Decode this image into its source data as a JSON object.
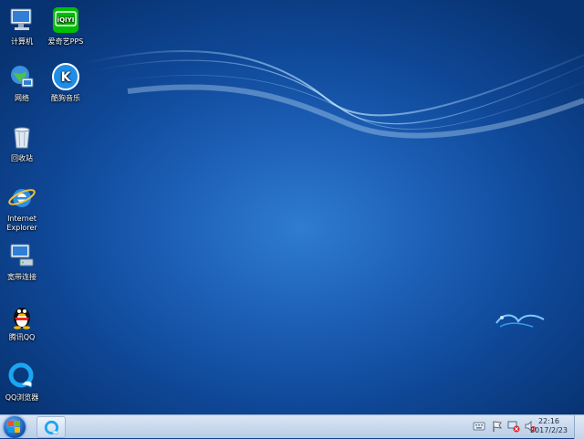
{
  "desktop_icons": [
    {
      "label": "计算机",
      "icon": "computer-icon"
    },
    {
      "label": "爱奇艺PPS",
      "icon": "iqiyi-icon",
      "badge_text": "iQIYI"
    },
    {
      "label": "网络",
      "icon": "network-icon"
    },
    {
      "label": "酷狗音乐",
      "icon": "kugou-icon",
      "badge_text": "K"
    },
    {
      "label": "回收站",
      "icon": "recycle-bin-icon"
    },
    {
      "label": "Internet Explorer",
      "icon": "ie-icon"
    },
    {
      "label": "宽带连接",
      "icon": "broadband-icon"
    },
    {
      "label": "腾讯QQ",
      "icon": "qq-penguin-icon"
    },
    {
      "label": "QQ浏览器",
      "icon": "qq-browser-icon"
    }
  ],
  "taskbar": {
    "start_icon": "windows-start-icon",
    "pinned": [
      {
        "icon": "qq-browser-icon"
      }
    ],
    "tray_icons": [
      "keyboard-icon",
      "flag-icon",
      "network-status-icon",
      "volume-muted-icon"
    ],
    "clock": {
      "time": "22:16",
      "date": "2017/2/23"
    }
  },
  "colors": {
    "desktop_bg": "#1c5fb6",
    "taskbar_bg": "#c9daee",
    "iqiyi_green": "#00be06",
    "kugou_blue": "#1e8ee9"
  }
}
